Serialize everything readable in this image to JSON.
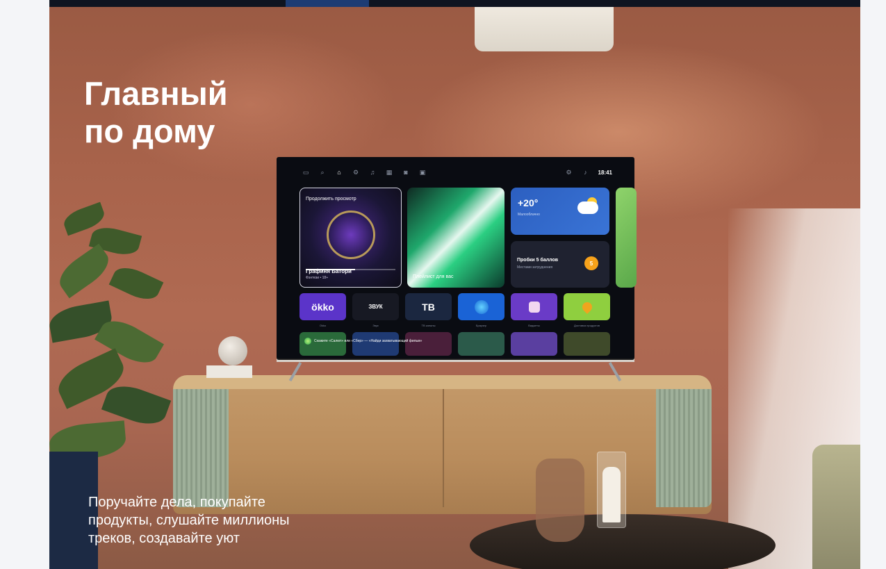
{
  "headline": {
    "line1": "Главный",
    "line2": "по дому"
  },
  "tagline": {
    "line1": "Поручайте дела, покупайте",
    "line2": "продукты, слушайте миллионы",
    "line3": "треков, создавайте уют"
  },
  "tv": {
    "time": "18:41",
    "nav_icons": [
      "tv-icon",
      "search-icon",
      "home-icon",
      "gear-icon",
      "music-icon",
      "grid-icon",
      "gamepad-icon",
      "store-icon"
    ],
    "continue_card": {
      "label": "Продолжить просмотр",
      "title": "Графиня Батори",
      "meta": "Фэнтези • 18+",
      "progress": 0.55
    },
    "playlist_card": {
      "label": "Плейлист для вас"
    },
    "weather_card": {
      "temp": "+20°",
      "desc": "Малооблачно"
    },
    "traffic_card": {
      "title": "Пробки 5 баллов",
      "desc": "Местами затруднения",
      "score": "5"
    },
    "apps": [
      {
        "label": "ökko",
        "caption": "Okko"
      },
      {
        "label": "ЗВУК",
        "caption": "Звук"
      },
      {
        "label": "ТВ",
        "caption": "ТВ каналы"
      },
      {
        "label": "",
        "caption": "Браузер"
      },
      {
        "label": "",
        "caption": "Виджеты"
      },
      {
        "label": "",
        "caption": "Доставка продуктов"
      }
    ],
    "assistant_hint": "Скажите «Салют» или «Сбер» — «Найди захватывающий фильм»"
  },
  "colors": {
    "wall": "#a8634b",
    "okko": "#5b34c9",
    "weather": "#2c5fc0",
    "traffic_score": "#f7a21b",
    "delivery": "#8fcf3f"
  }
}
